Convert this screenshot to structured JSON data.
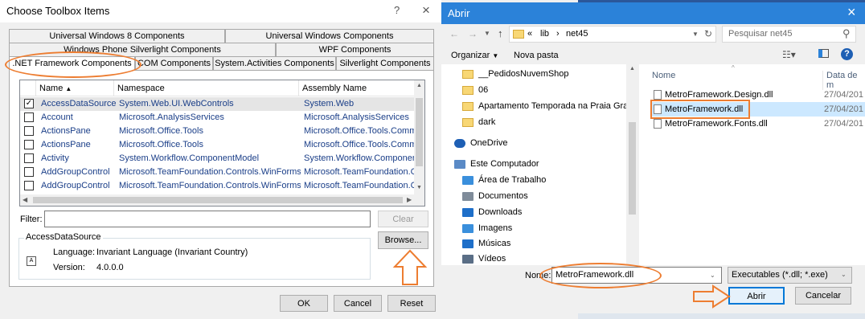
{
  "toolbox": {
    "title": "Choose Toolbox Items",
    "help_icon": "?",
    "close_icon": "×",
    "tabs_row1": [
      "Universal Windows 8 Components",
      "Universal Windows Components"
    ],
    "tabs_row2": [
      "Windows Phone Silverlight Components",
      "WPF Components"
    ],
    "tabs_row3": [
      ".NET Framework Components",
      "COM Components",
      "System.Activities Components",
      "Silverlight Components"
    ],
    "columns": [
      "Name",
      "Namespace",
      "Assembly Name"
    ],
    "rows": [
      {
        "checked": true,
        "name": "AccessDataSource",
        "namespace": "System.Web.UI.WebControls",
        "assembly": "System.Web"
      },
      {
        "checked": false,
        "name": "Account",
        "namespace": "Microsoft.AnalysisServices",
        "assembly": "Microsoft.AnalysisServices"
      },
      {
        "checked": false,
        "name": "ActionsPane",
        "namespace": "Microsoft.Office.Tools",
        "assembly": "Microsoft.Office.Tools.Comm"
      },
      {
        "checked": false,
        "name": "ActionsPane",
        "namespace": "Microsoft.Office.Tools",
        "assembly": "Microsoft.Office.Tools.Comm"
      },
      {
        "checked": false,
        "name": "Activity",
        "namespace": "System.Workflow.ComponentModel",
        "assembly": "System.Workflow.Component"
      },
      {
        "checked": false,
        "name": "AddGroupControl",
        "namespace": "Microsoft.TeamFoundation.Controls.WinForms",
        "assembly": "Microsoft.TeamFoundation.Co"
      },
      {
        "checked": false,
        "name": "AddGroupControl",
        "namespace": "Microsoft.TeamFoundation.Controls.WinForms",
        "assembly": "Microsoft.TeamFoundation.Co"
      }
    ],
    "filter_label": "Filter:",
    "filter_value": "",
    "clear_label": "Clear",
    "group_title": "AccessDataSource",
    "language_label": "Language:",
    "language_value": "Invariant Language (Invariant Country)",
    "version_label": "Version:",
    "version_value": "4.0.0.0",
    "browse_label": "Browse...",
    "ok_label": "OK",
    "cancel_label": "Cancel",
    "reset_label": "Reset"
  },
  "open_dialog": {
    "title": "Abrir",
    "close_icon": "×",
    "breadcrumb": [
      "«",
      "lib",
      "›",
      "net45"
    ],
    "search_placeholder": "Pesquisar net45",
    "organize_label": "Organizar",
    "new_folder_label": "Nova pasta",
    "nav_items": [
      {
        "label": "__PedidosNuvemShop",
        "icon": "folder-icon"
      },
      {
        "label": "06",
        "icon": "folder-icon"
      },
      {
        "label": "Apartamento Temporada na Praia Gran",
        "icon": "folder-icon"
      },
      {
        "label": "dark",
        "icon": "folder-icon"
      },
      {
        "label": "OneDrive",
        "icon": "cloud-icon"
      },
      {
        "label": "Este Computador",
        "icon": "computer-icon"
      },
      {
        "label": "Área de Trabalho",
        "icon": "desktop-icon"
      },
      {
        "label": "Documentos",
        "icon": "documents-icon"
      },
      {
        "label": "Downloads",
        "icon": "downloads-icon"
      },
      {
        "label": "Imagens",
        "icon": "images-icon"
      },
      {
        "label": "Músicas",
        "icon": "music-icon"
      },
      {
        "label": "Vídeos",
        "icon": "videos-icon"
      }
    ],
    "col_name": "Nome",
    "col_date": "Data de m",
    "files": [
      {
        "name": "MetroFramework.Design.dll",
        "date": "27/04/201",
        "selected": false
      },
      {
        "name": "MetroFramework.dll",
        "date": "27/04/201",
        "selected": true
      },
      {
        "name": "MetroFramework.Fonts.dll",
        "date": "27/04/201",
        "selected": false
      }
    ],
    "filename_label": "Nome:",
    "filename_value": "MetroFramework.dll",
    "filetype_value": "Executables (*.dll; *.exe)",
    "open_label": "Abrir",
    "cancel_label": "Cancelar"
  }
}
